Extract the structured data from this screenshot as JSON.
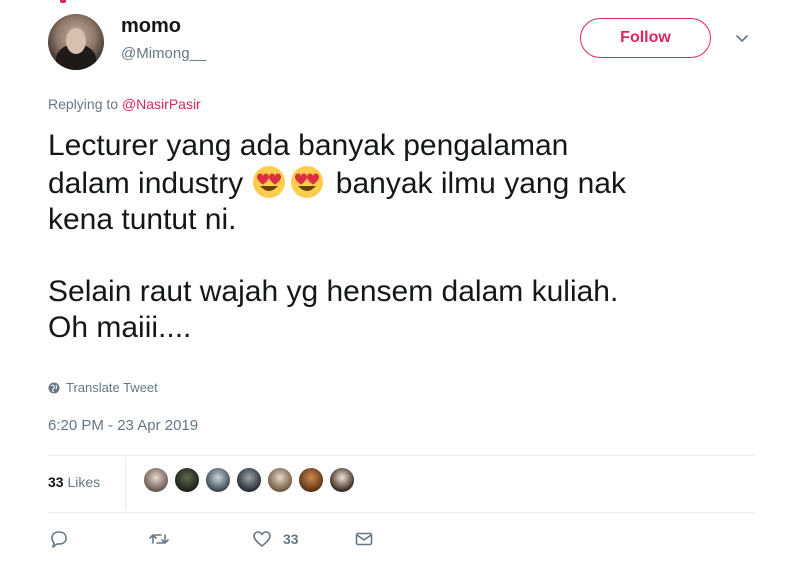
{
  "user": {
    "name": "momo",
    "handle": "@Mimong__"
  },
  "follow_label": "Follow",
  "replying": {
    "prefix": "Replying to ",
    "mention": "@NasirPasir"
  },
  "tweet": {
    "line1": "Lecturer yang ada banyak pengalaman",
    "line2a": "dalam industry",
    "line2b": "banyak ilmu yang nak",
    "line3": "kena tuntut ni.",
    "line4": "Selain raut wajah yg hensem dalam kuliah.",
    "line5": "Oh maiii...."
  },
  "translate_label": "Translate Tweet",
  "timestamp": "6:20 PM - 23 Apr 2019",
  "likes": {
    "count": "33",
    "label": "Likes"
  },
  "actions": {
    "like_count": "33"
  },
  "colors": {
    "accent": "#e0245e",
    "secondary_text": "#657786",
    "primary_text": "#14171a",
    "divider": "#e6ecf0"
  },
  "icons": [
    "chevron-down-icon",
    "globe-icon",
    "heart-eyes-emoji",
    "reply-icon",
    "retweet-icon",
    "heart-icon",
    "message-icon"
  ]
}
